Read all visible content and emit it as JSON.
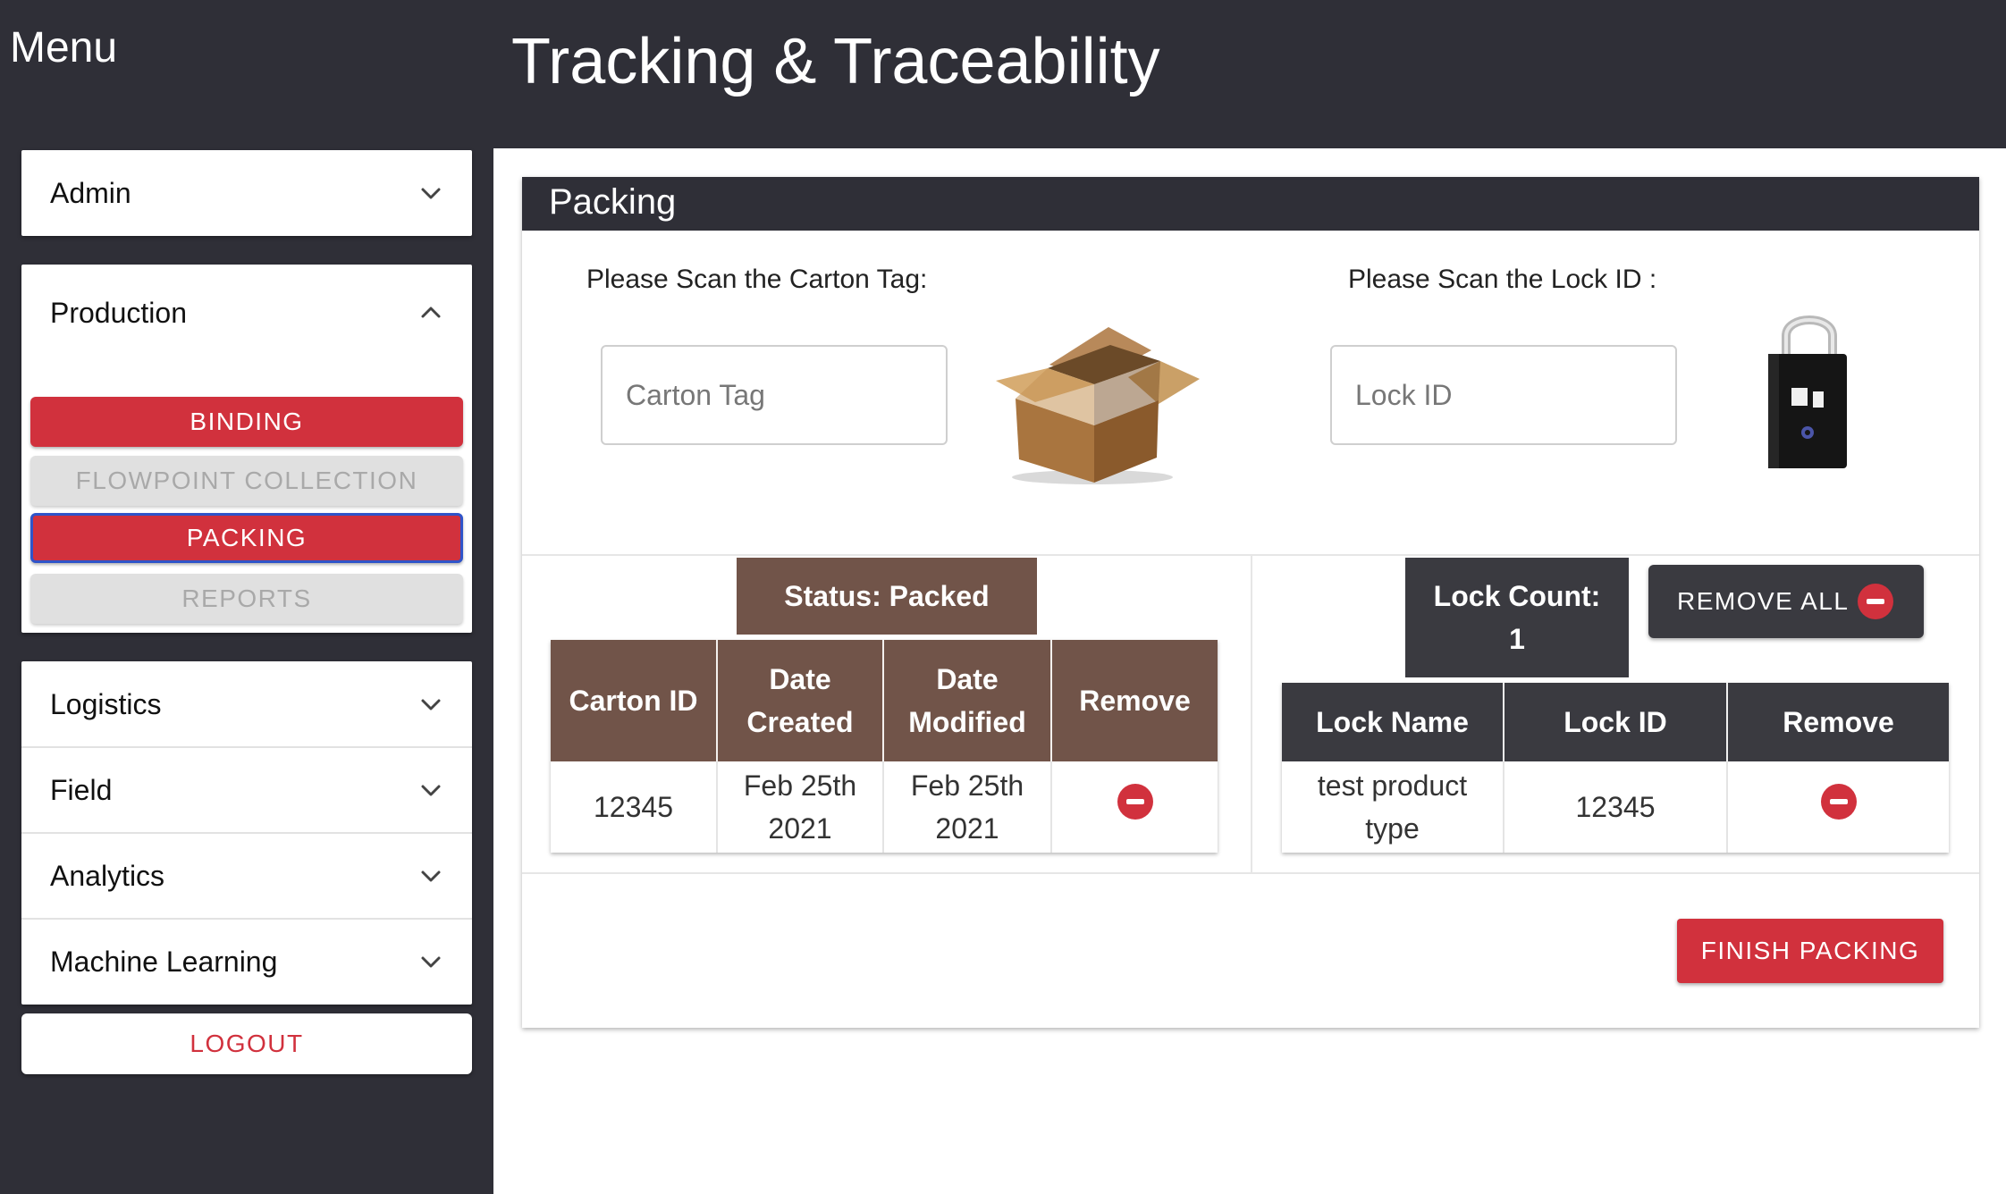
{
  "sidebar": {
    "menu_title": "Menu",
    "sections": {
      "admin": "Admin",
      "production": "Production",
      "logistics": "Logistics",
      "field": "Field",
      "analytics": "Analytics",
      "machine_learning": "Machine Learning"
    },
    "production_items": [
      {
        "label": "BINDING",
        "state": "active"
      },
      {
        "label": "FLOWPOINT COLLECTION",
        "state": "inactive"
      },
      {
        "label": "PACKING",
        "state": "active-selected"
      },
      {
        "label": "REPORTS",
        "state": "inactive"
      }
    ],
    "logout_label": "LOGOUT"
  },
  "header": {
    "title": "Tracking & Traceability"
  },
  "packing": {
    "title": "Packing",
    "carton_scan": {
      "label": "Please Scan the Carton Tag:",
      "placeholder": "Carton Tag",
      "value": ""
    },
    "lock_scan": {
      "label": "Please Scan the Lock ID :",
      "placeholder": "Lock ID",
      "value": ""
    },
    "status_label": "Status: Packed",
    "carton_table": {
      "headers": [
        "Carton ID",
        "Date Created",
        "Date Modified",
        "Remove"
      ],
      "rows": [
        {
          "carton_id": "12345",
          "date_created": "Feb 25th 2021",
          "date_modified": "Feb 25th 2021"
        }
      ]
    },
    "lock_count": {
      "label": "Lock Count:",
      "value": "1"
    },
    "remove_all_label": "REMOVE ALL",
    "lock_table": {
      "headers": [
        "Lock Name",
        "Lock ID",
        "Remove"
      ],
      "rows": [
        {
          "lock_name": "test product type",
          "lock_id": "12345"
        }
      ]
    },
    "finish_label": "FINISH PACKING"
  },
  "colors": {
    "dark": "#2f2f37",
    "accent_red": "#d1313d",
    "brown": "#715449",
    "selected_border": "#2f54c9"
  },
  "icons": [
    "chevron-down-icon",
    "chevron-up-icon",
    "cardboard-box-icon",
    "padlock-icon",
    "minus-circle-icon"
  ]
}
